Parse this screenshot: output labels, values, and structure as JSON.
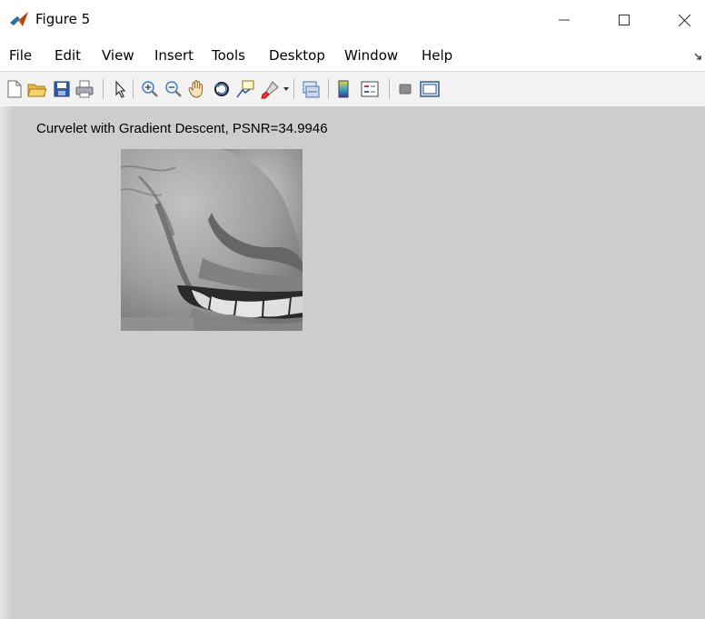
{
  "window": {
    "title": "Figure 5",
    "controls": {
      "minimize": "—",
      "maximize": "☐",
      "close": "✕"
    }
  },
  "menu": [
    "File",
    "Edit",
    "View",
    "Insert",
    "Tools",
    "Desktop",
    "Window",
    "Help"
  ],
  "toolbar": {
    "icons": [
      "new-figure-icon",
      "open-file-icon",
      "save-icon",
      "print-icon",
      "select-arrow-icon",
      "zoom-in-icon",
      "zoom-out-icon",
      "pan-hand-icon",
      "rotate-3d-icon",
      "data-cursor-icon",
      "brush-icon",
      "link-plot-icon",
      "colorbar-icon",
      "legend-icon",
      "hide-plot-tools-icon",
      "show-plot-tools-icon"
    ]
  },
  "figure": {
    "axes_title": "Curvelet with Gradient Descent, PSNR=34.9946",
    "image": "grayscale face close-up (cheek, nose, smiling mouth with teeth)"
  },
  "colors": {
    "canvas_bg": "#cdcdcd",
    "toolbar_bg": "#f2f2f2",
    "matlab_orange": "#e8731c"
  }
}
